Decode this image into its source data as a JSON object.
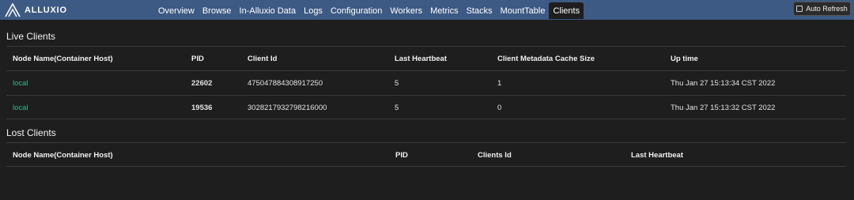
{
  "brand": {
    "name": "ALLUXIO"
  },
  "nav": {
    "items": [
      {
        "label": "Overview"
      },
      {
        "label": "Browse"
      },
      {
        "label": "In-Alluxio Data"
      },
      {
        "label": "Logs"
      },
      {
        "label": "Configuration"
      },
      {
        "label": "Workers"
      },
      {
        "label": "Metrics"
      },
      {
        "label": "Stacks"
      },
      {
        "label": "MountTable"
      },
      {
        "label": "Clients",
        "active": true
      }
    ]
  },
  "toolbar": {
    "auto_refresh_label": "Auto Refresh",
    "auto_refresh_checked": false
  },
  "live_clients": {
    "title": "Live Clients",
    "columns": [
      "Node Name(Container Host)",
      "PID",
      "Client Id",
      "Last Heartbeat",
      "Client Metadata Cache Size",
      "Up time"
    ],
    "rows": [
      {
        "node": "local",
        "pid": "22602",
        "client_id": "475047884308917250",
        "last_heartbeat": "5",
        "cache_size": "1",
        "uptime": "Thu Jan 27 15:13:34 CST 2022"
      },
      {
        "node": "local",
        "pid": "19536",
        "client_id": "3028217932798216000",
        "last_heartbeat": "5",
        "cache_size": "0",
        "uptime": "Thu Jan 27 15:13:32 CST 2022"
      }
    ]
  },
  "lost_clients": {
    "title": "Lost Clients",
    "columns": [
      "Node Name(Container Host)",
      "PID",
      "Clients Id",
      "Last Heartbeat"
    ],
    "rows": []
  },
  "colors": {
    "header_bg": "#3d5a84",
    "page_bg": "#1e1e1e",
    "link": "#3fb68b"
  }
}
